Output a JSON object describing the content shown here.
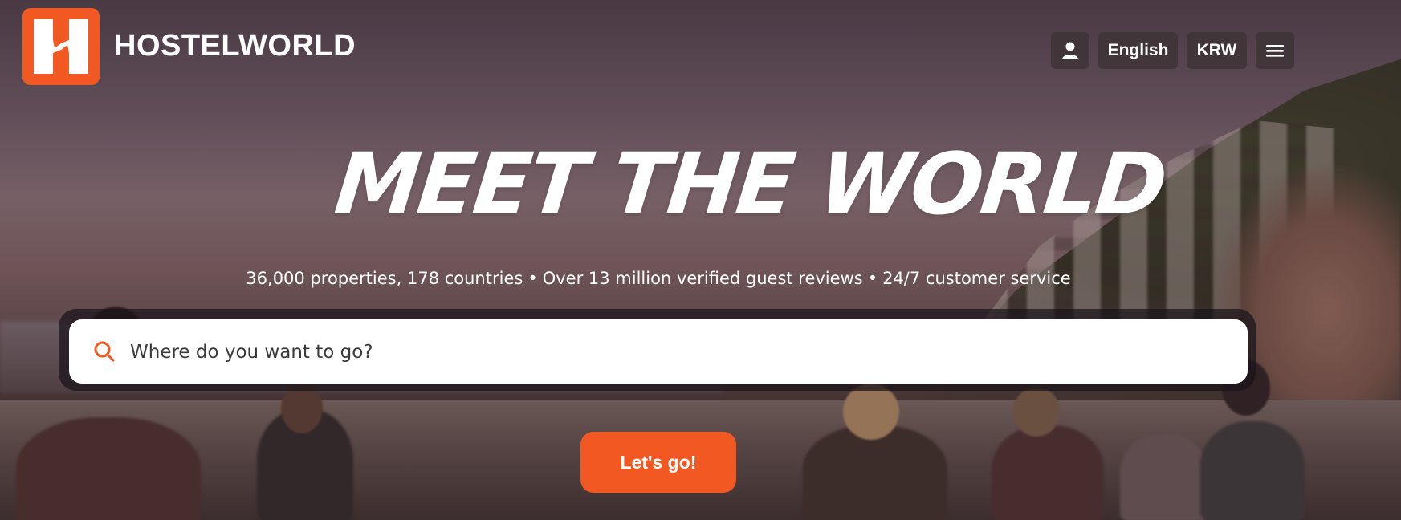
{
  "brand": {
    "name": "HOSTELWORLD",
    "logo_color": "#f25822"
  },
  "header": {
    "user_icon": "user-icon",
    "language": "English",
    "currency": "KRW",
    "menu_icon": "hamburger-menu-icon"
  },
  "hero": {
    "headline": "MEET THE WORLD",
    "stats": [
      "36,000 properties, 178 countries",
      "Over 13 million verified guest reviews",
      "24/7 customer service"
    ],
    "separator": "•"
  },
  "search": {
    "icon": "search-icon",
    "placeholder": "Where do you want to go?",
    "value": ""
  },
  "cta": {
    "label": "Let's go!",
    "color": "#f25822"
  }
}
